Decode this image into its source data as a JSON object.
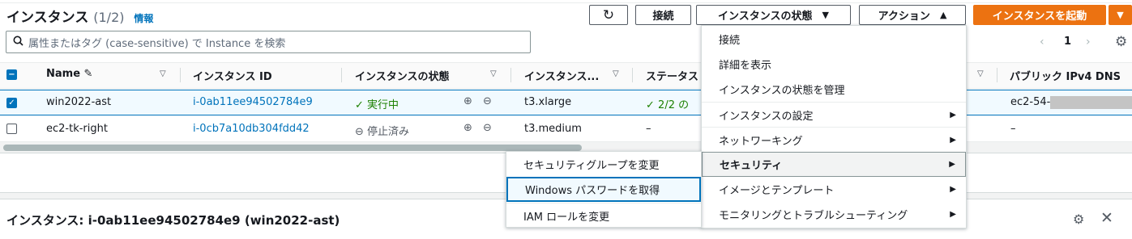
{
  "header": {
    "title": "インスタンス",
    "count": "(1/2)",
    "info_link": "情報",
    "buttons": {
      "connect": "接続",
      "instance_state": "インスタンスの状態",
      "actions": "アクション",
      "launch": "インスタンスを起動"
    }
  },
  "search": {
    "placeholder": "属性またはタグ (case-sensitive) で Instance を検索"
  },
  "pagination": {
    "current_page": "1"
  },
  "table": {
    "columns": [
      "Name",
      "インスタンス ID",
      "インスタンスの状態",
      "インスタンス...",
      "ステータス",
      "パブリック IPv4 DNS"
    ],
    "rows": [
      {
        "selected": true,
        "name": "win2022-ast",
        "instance_id": "i-0ab11ee94502784e9",
        "state": "実行中",
        "type": "t3.xlarge",
        "status": "2/2 の",
        "dns": "ec2-54-"
      },
      {
        "selected": false,
        "name": "ec2-tk-right",
        "instance_id": "i-0cb7a10db304fdd42",
        "state": "停止済み",
        "type": "t3.medium",
        "status": "–",
        "dns": "–"
      }
    ]
  },
  "actions_menu": {
    "items": [
      {
        "label": "接続",
        "has_submenu": false
      },
      {
        "label": "詳細を表示",
        "has_submenu": false
      },
      {
        "label": "インスタンスの状態を管理",
        "has_submenu": false
      },
      {
        "label": "インスタンスの設定",
        "has_submenu": true
      },
      {
        "label": "ネットワーキング",
        "has_submenu": true
      },
      {
        "label": "セキュリティ",
        "has_submenu": true,
        "active": true
      },
      {
        "label": "イメージとテンプレート",
        "has_submenu": true
      },
      {
        "label": "モニタリングとトラブルシューティング",
        "has_submenu": true
      }
    ]
  },
  "security_submenu": {
    "items": [
      {
        "label": "セキュリティグループを変更"
      },
      {
        "label": "Windows パスワードを取得",
        "focused": true
      },
      {
        "label": "IAM ロールを変更"
      }
    ]
  },
  "details": {
    "title": "インスタンス: i-0ab11ee94502784e9 (win2022-ast)"
  },
  "colors": {
    "accent": "#0073bb",
    "primary": "#ec7211",
    "success": "#1d8102"
  }
}
